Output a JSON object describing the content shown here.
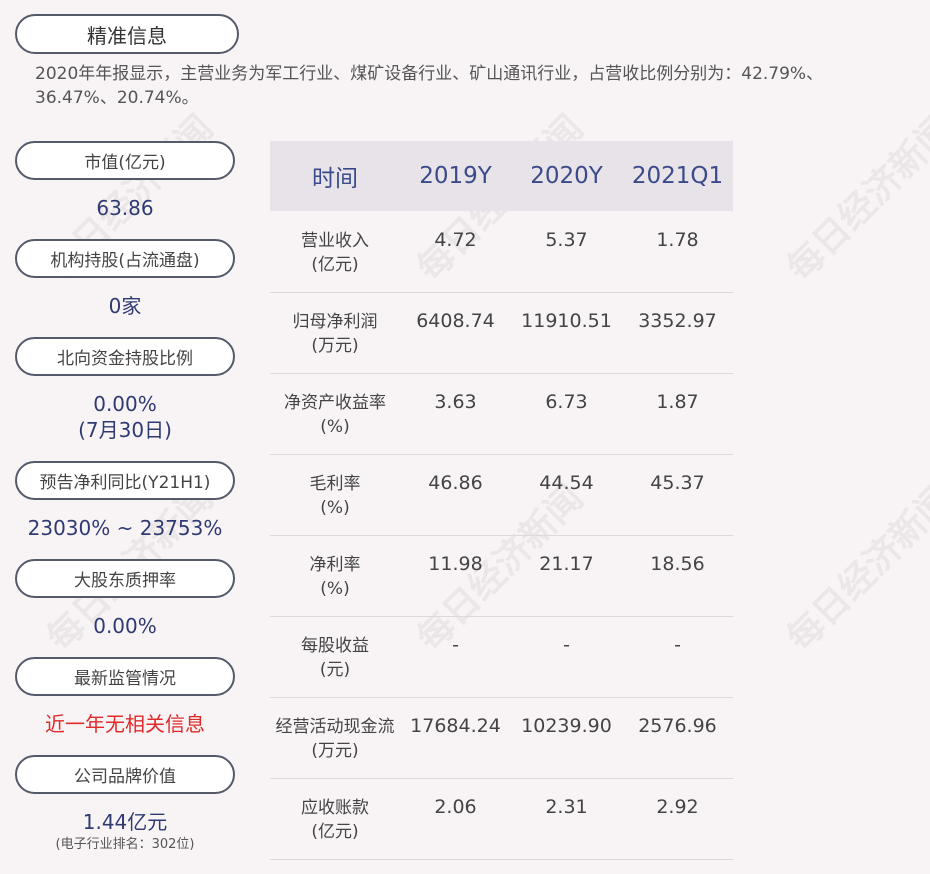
{
  "header": {
    "title": "精准信息",
    "summary": "2020年年报显示，主营业务为军工行业、煤矿设备行业、矿山通讯行业，占营收比例分别为：42.79%、36.47%、20.74%。"
  },
  "sidebar": [
    {
      "label": "市值(亿元)",
      "value": "63.86"
    },
    {
      "label": "机构持股(占流通盘)",
      "value": "0家"
    },
    {
      "label": "北向资金持股比例",
      "value": "0.00%",
      "value2": "(7月30日)"
    },
    {
      "label": "预告净利同比(Y21H1)",
      "value": "23030% ~ 23753%"
    },
    {
      "label": "大股东质押率",
      "value": "0.00%"
    },
    {
      "label": "最新监管情况",
      "value": "近一年无相关信息"
    },
    {
      "label": "公司品牌价值",
      "value": "1.44亿元",
      "note": "(电子行业排名：302位)"
    }
  ],
  "table": {
    "headers": [
      "时间",
      "2019Y",
      "2020Y",
      "2021Q1"
    ],
    "rows": [
      {
        "label": "营业收入",
        "unit": "(亿元)",
        "values": [
          "4.72",
          "5.37",
          "1.78"
        ]
      },
      {
        "label": "归母净利润",
        "unit": "(万元)",
        "values": [
          "6408.74",
          "11910.51",
          "3352.97"
        ]
      },
      {
        "label": "净资产收益率",
        "unit": "(%)",
        "values": [
          "3.63",
          "6.73",
          "1.87"
        ]
      },
      {
        "label": "毛利率",
        "unit": "(%)",
        "values": [
          "46.86",
          "44.54",
          "45.37"
        ]
      },
      {
        "label": "净利率",
        "unit": "(%)",
        "values": [
          "11.98",
          "21.17",
          "18.56"
        ]
      },
      {
        "label": "每股收益",
        "unit": "(元)",
        "values": [
          "-",
          "-",
          "-"
        ]
      },
      {
        "label": "经营活动现金流",
        "unit": "(万元)",
        "values": [
          "17684.24",
          "10239.90",
          "2576.96"
        ]
      },
      {
        "label": "应收账款",
        "unit": "(亿元)",
        "values": [
          "2.06",
          "2.31",
          "2.92"
        ]
      }
    ]
  },
  "watermark": "每日经济新闻"
}
